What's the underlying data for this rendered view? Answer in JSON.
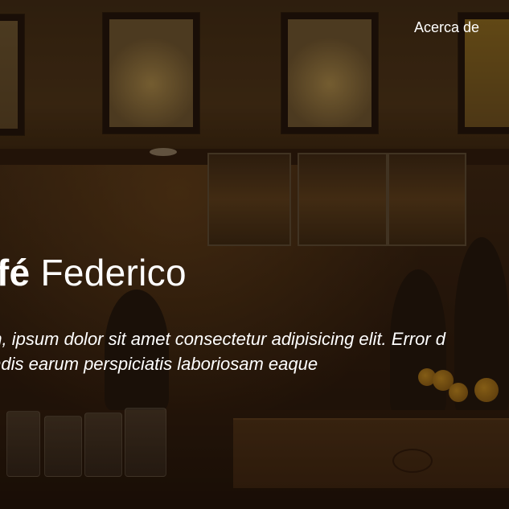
{
  "nav": {
    "about_label": "Acerca de"
  },
  "hero": {
    "title_bold": "afé",
    "title_regular": "Federico",
    "subtitle_line1": "em, ipsum dolor sit amet consectetur adipisicing elit. Error d",
    "subtitle_line2": "iendis earum perspiciatis laboriosam eaque"
  },
  "colors": {
    "text": "#ffffff",
    "background": "#2e1d0e"
  }
}
